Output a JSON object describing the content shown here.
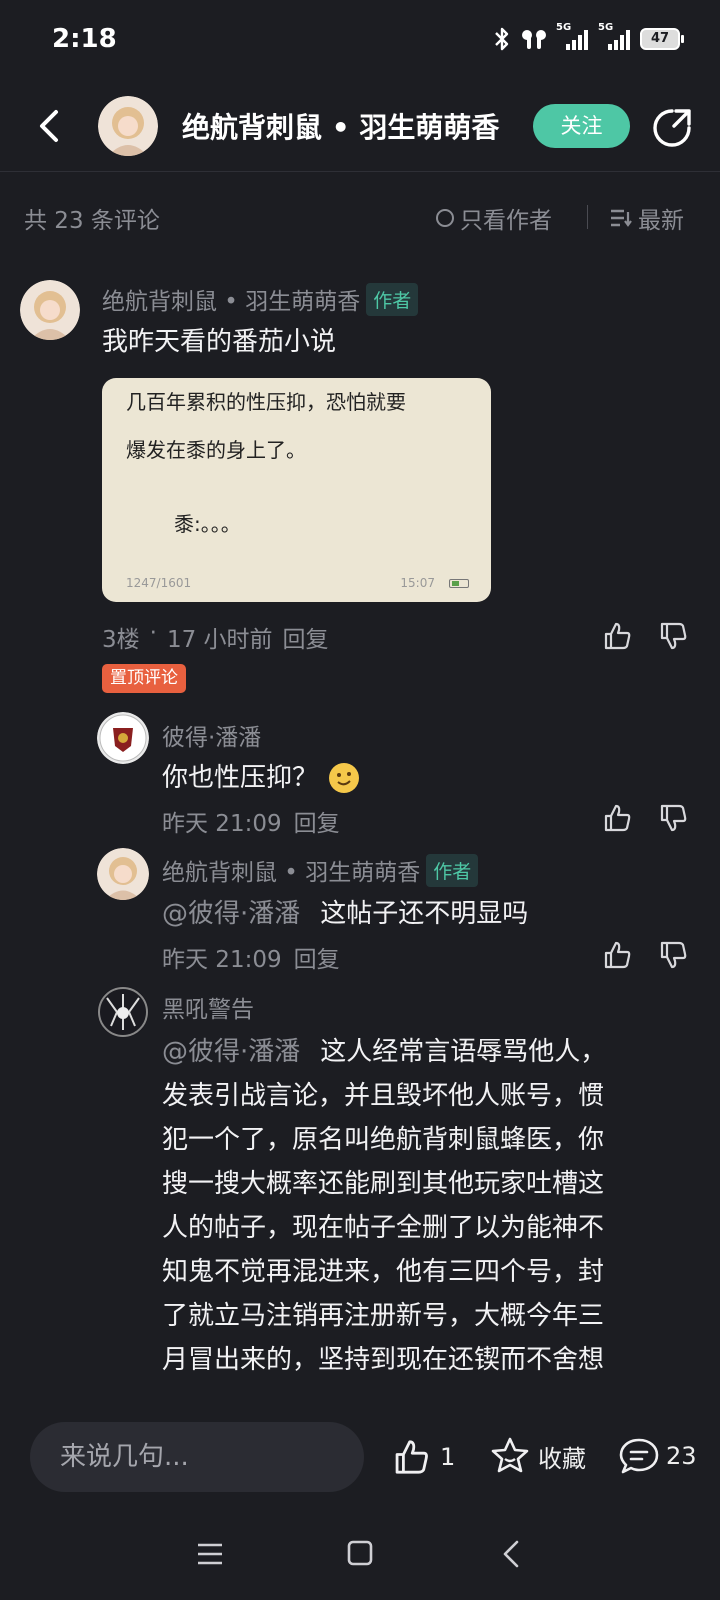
{
  "status_bar": {
    "time": "2:18",
    "battery": "47",
    "net1": "5G",
    "net2": "5G"
  },
  "header": {
    "title": "绝航背刺鼠 • 羽生萌萌香",
    "follow_label": "关注"
  },
  "filters": {
    "count_label": "共 23 条评论",
    "only_author_label": "只看作者",
    "sort_label": "最新"
  },
  "main_comment": {
    "author": "绝航背刺鼠 • 羽生萌萌香",
    "author_badge": "作者",
    "text": "我昨天看的番茄小说",
    "image": {
      "line1": "几百年累积的性压抑，恐怕就要",
      "line2": "爆发在黍的身上了。",
      "line3": "黍:。。。",
      "page": "1247/1601",
      "time": "15:07"
    },
    "floor": "3楼",
    "time": "17 小时前",
    "reply_label": "回复",
    "pinned_label": "置顶评论"
  },
  "replies": [
    {
      "author": "彼得·潘潘",
      "text": "你也性压抑？",
      "emoji": "🙂",
      "time": "昨天 21:09",
      "reply_label": "回复"
    },
    {
      "author": "绝航背刺鼠 • 羽生萌萌香",
      "author_badge": "作者",
      "mention": "@彼得·潘潘",
      "text": "这帖子还不明显吗",
      "time": "昨天 21:09",
      "reply_label": "回复"
    },
    {
      "author": "黑吼警告",
      "mention": "@彼得·潘潘",
      "lines": [
        "这人经常言语辱骂他人，",
        "发表引战言论，并且毁坏他人账号，惯",
        "犯一个了，原名叫绝航背刺鼠蜂医，你",
        "搜一搜大概率还能刷到其他玩家吐槽这",
        "人的帖子，现在帖子全删了以为能神不",
        "知鬼不觉再混进来，他有三四个号，封",
        "了就立马注销再注册新号，大概今年三",
        "月冒出来的，坚持到现在还锲而不舍想"
      ]
    }
  ],
  "bottom_bar": {
    "input_placeholder": "来说几句...",
    "like_count": "1",
    "favorite_label": "收藏",
    "comment_count": "23"
  },
  "colors": {
    "background": "#1c1d22",
    "accent": "#4ec7a5",
    "pinned": "#e8603f",
    "muted_text": "#8b8d94"
  }
}
